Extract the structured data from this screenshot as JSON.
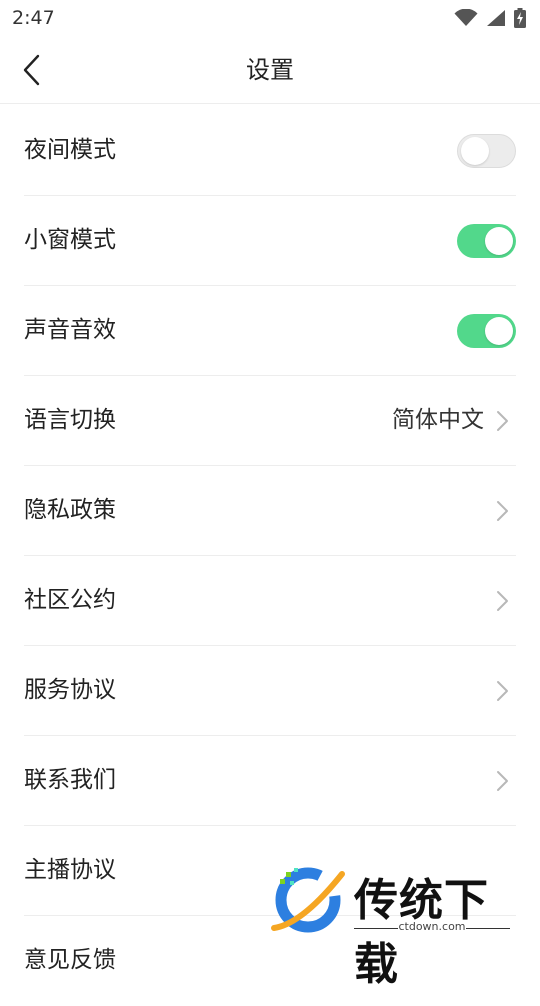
{
  "status_bar": {
    "time": "2:47"
  },
  "header": {
    "title": "设置"
  },
  "settings": {
    "night_mode": {
      "label": "夜间模式",
      "enabled": false
    },
    "mini_window": {
      "label": "小窗模式",
      "enabled": true
    },
    "sound_effects": {
      "label": "声音音效",
      "enabled": true
    },
    "language": {
      "label": "语言切换",
      "value": "简体中文"
    },
    "privacy_policy": {
      "label": "隐私政策"
    },
    "community_rules": {
      "label": "社区公约"
    },
    "service_agreement": {
      "label": "服务协议"
    },
    "contact_us": {
      "label": "联系我们"
    },
    "streamer_agreement": {
      "label": "主播协议"
    },
    "feedback": {
      "label": "意见反馈"
    }
  },
  "watermark": {
    "brand": "传统下载",
    "url": "ctdown.com"
  },
  "colors": {
    "toggle_on": "#52d88b",
    "toggle_off": "#ececec",
    "divider": "#ededed"
  },
  "icons": [
    "wifi-icon",
    "cell-signal-icon",
    "battery-charging-icon",
    "back-arrow-icon",
    "chevron-right-icon"
  ]
}
